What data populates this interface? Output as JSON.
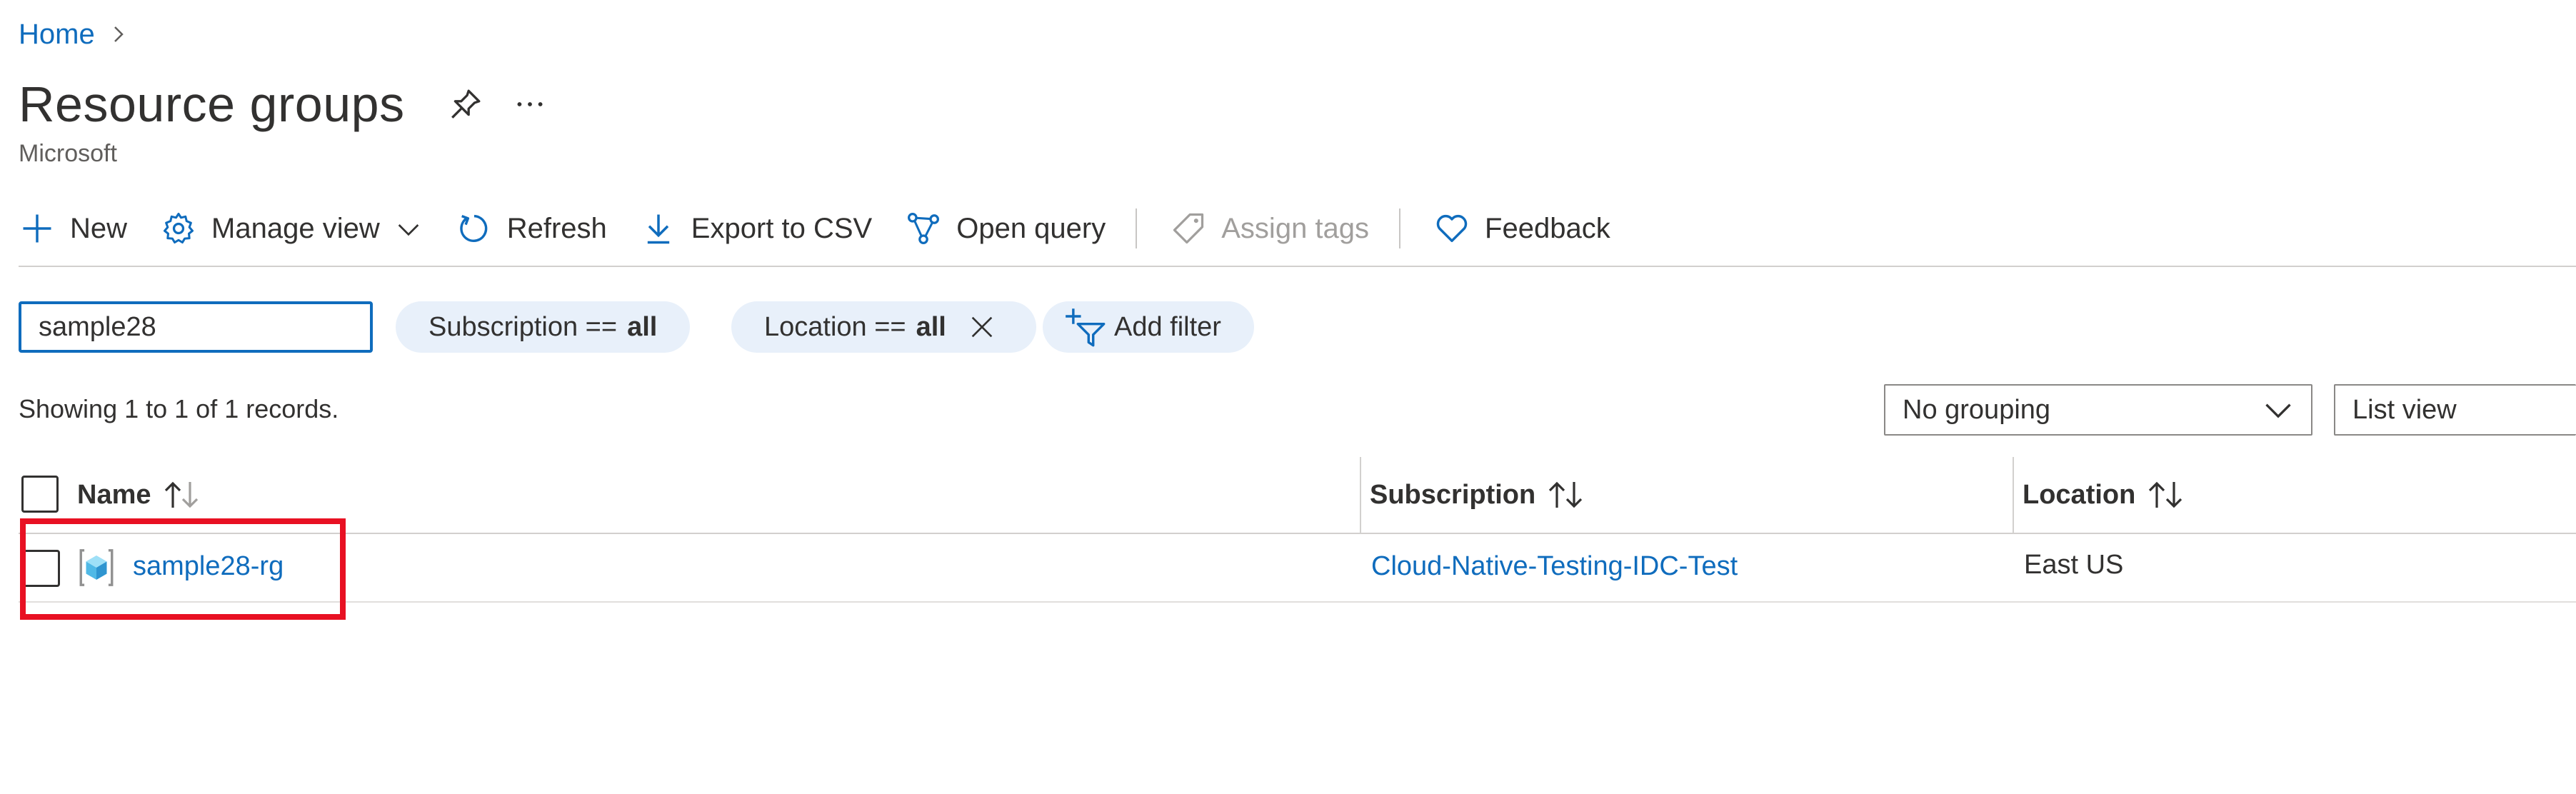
{
  "breadcrumb": {
    "home": "Home"
  },
  "header": {
    "title": "Resource groups",
    "subtitle": "Microsoft"
  },
  "toolbar": {
    "new": "New",
    "manage_view": "Manage view",
    "refresh": "Refresh",
    "export_csv": "Export to CSV",
    "open_query": "Open query",
    "assign_tags": "Assign tags",
    "feedback": "Feedback"
  },
  "filters": {
    "search_value": "sample28",
    "subscription_label": "Subscription ==",
    "subscription_value": "all",
    "location_label": "Location ==",
    "location_value": "all",
    "add_filter": "Add filter"
  },
  "records": {
    "summary": "Showing 1 to 1 of 1 records."
  },
  "views": {
    "grouping": "No grouping",
    "view": "List view"
  },
  "table": {
    "columns": {
      "name": "Name",
      "subscription": "Subscription",
      "location": "Location"
    },
    "rows": [
      {
        "name": "sample28-rg",
        "subscription": "Cloud-Native-Testing-IDC-Test",
        "location": "East US"
      }
    ]
  },
  "colors": {
    "accent": "#0f6cbd",
    "pill_bg": "#e8f0fa",
    "highlight": "#e81123"
  }
}
